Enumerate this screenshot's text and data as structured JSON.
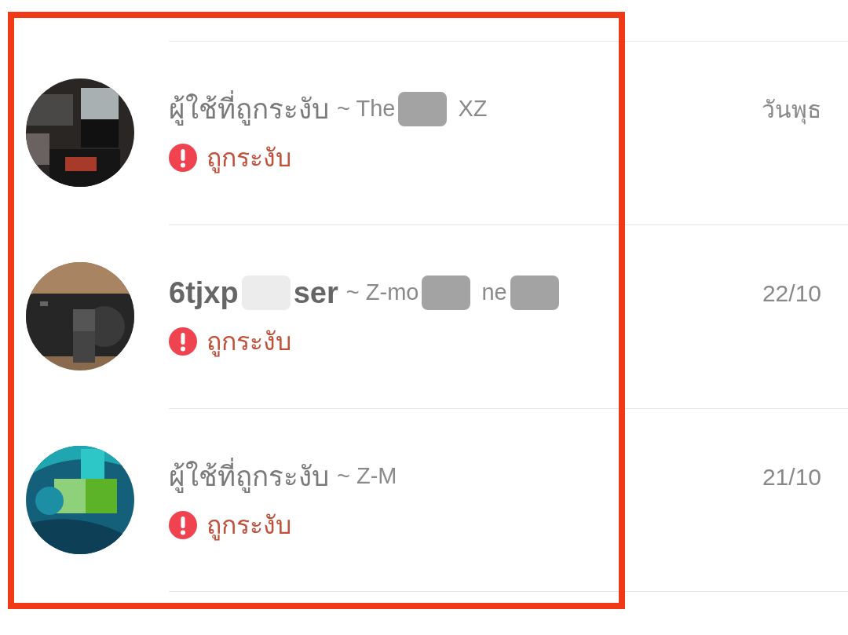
{
  "chats": [
    {
      "avatar": {
        "kind": "picture"
      },
      "name": [
        {
          "kind": "text",
          "text": "ผู้ใช้ที่ถูกระงับ"
        }
      ],
      "name_bold": false,
      "group": [
        {
          "kind": "text",
          "text": "~ The"
        },
        {
          "kind": "redaction",
          "faint": false
        },
        {
          "kind": "text",
          "text": "XZ"
        }
      ],
      "status": "ถูกระงับ",
      "time": "วันพุธ"
    },
    {
      "avatar": {
        "kind": "picture"
      },
      "name": [
        {
          "kind": "text",
          "text": "6tjxp"
        },
        {
          "kind": "redaction",
          "faint": true
        },
        {
          "kind": "text",
          "text": "ser"
        }
      ],
      "name_bold": true,
      "group": [
        {
          "kind": "text",
          "text": "~ Z-mo"
        },
        {
          "kind": "redaction",
          "faint": false
        },
        {
          "kind": "text",
          "text": "ne"
        },
        {
          "kind": "redaction",
          "faint": false
        }
      ],
      "status": "ถูกระงับ",
      "time": "22/10"
    },
    {
      "avatar": {
        "kind": "picture"
      },
      "name": [
        {
          "kind": "text",
          "text": "ผู้ใช้ที่ถูกระงับ"
        }
      ],
      "name_bold": false,
      "group": [
        {
          "kind": "text",
          "text": "~ Z-M"
        }
      ],
      "status": "ถูกระงับ",
      "time": "21/10"
    }
  ]
}
